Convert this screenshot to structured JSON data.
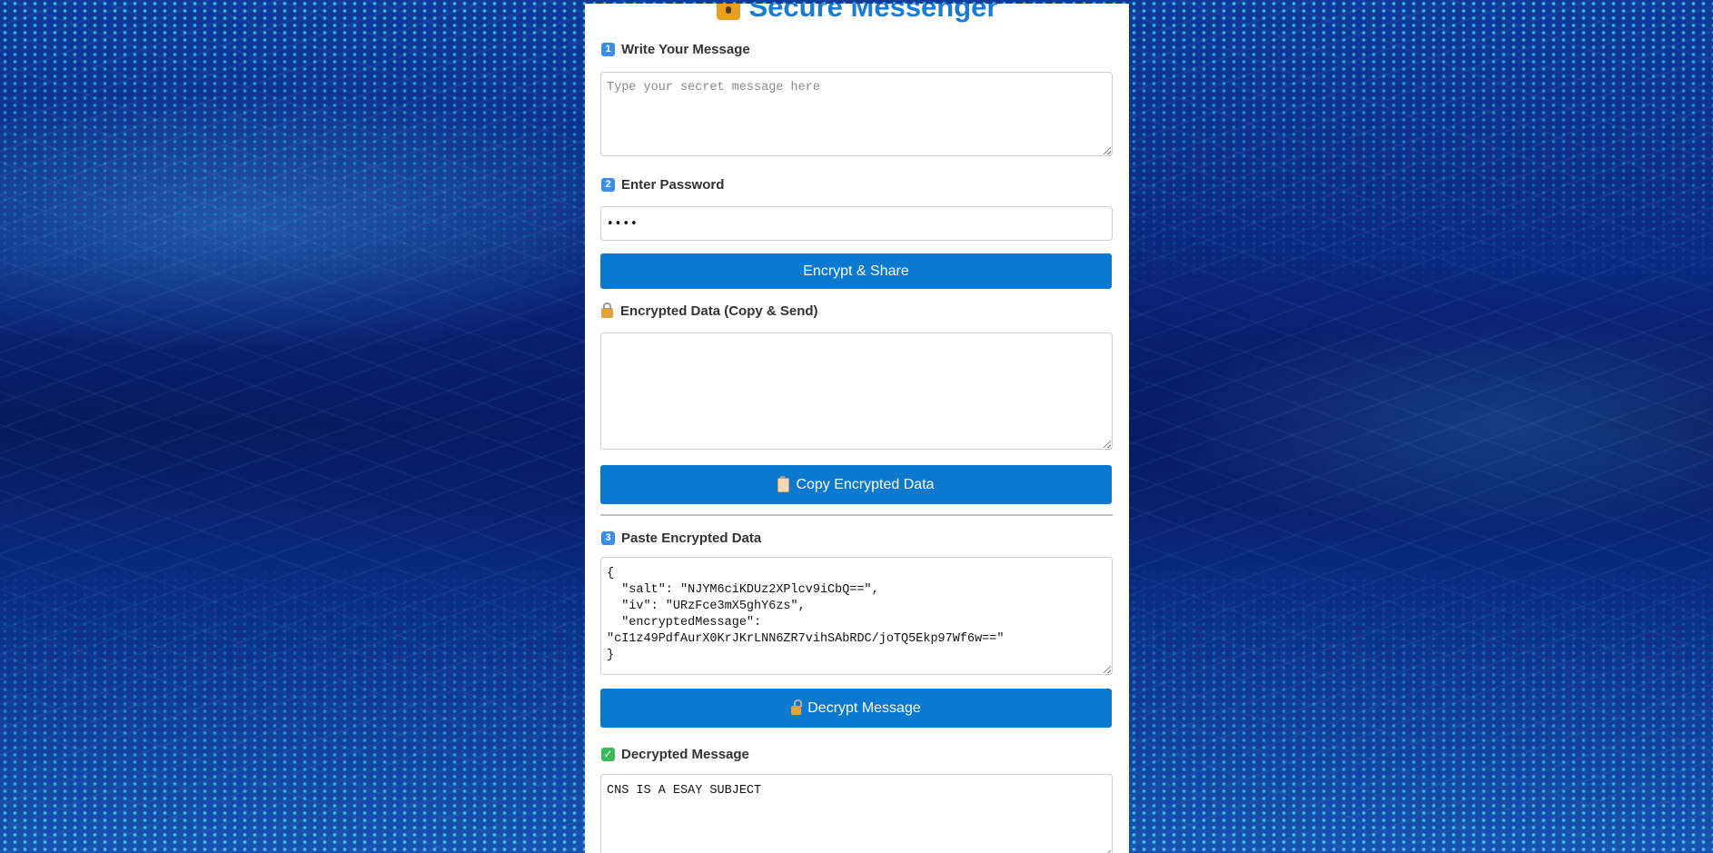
{
  "app": {
    "title": "Secure Messenger",
    "accent_color": "#0a79cf",
    "title_color": "#1a7cd1"
  },
  "step1": {
    "badge": "1",
    "label": "Write Your Message",
    "placeholder": "Type your secret message here",
    "value": ""
  },
  "step2": {
    "badge": "2",
    "label": "Enter Password",
    "value": "••••"
  },
  "encrypt_button": {
    "label": "Encrypt & Share"
  },
  "encrypted_output": {
    "label": "Encrypted Data (Copy & Send)",
    "icon": "lock-icon",
    "value": ""
  },
  "copy_button": {
    "label": "Copy Encrypted Data",
    "icon": "clipboard-icon"
  },
  "step3": {
    "badge": "3",
    "label": "Paste Encrypted Data",
    "value": "{\n  \"salt\": \"NJYM6ciKDUz2XPlcv9iCbQ==\",\n  \"iv\": \"URzFce3mX5ghY6zs\",\n  \"encryptedMessage\": \n\"cI1z49PdfAurX0KrJKrLNN6ZR7vihSAbRDC/joTQ5Ekp97Wf6w==\"\n}"
  },
  "decrypt_button": {
    "label": "Decrypt Message",
    "icon": "unlock-icon"
  },
  "decrypted_output": {
    "label": "Decrypted Message",
    "icon": "check-icon",
    "value": "CNS IS A ESAY SUBJECT"
  }
}
